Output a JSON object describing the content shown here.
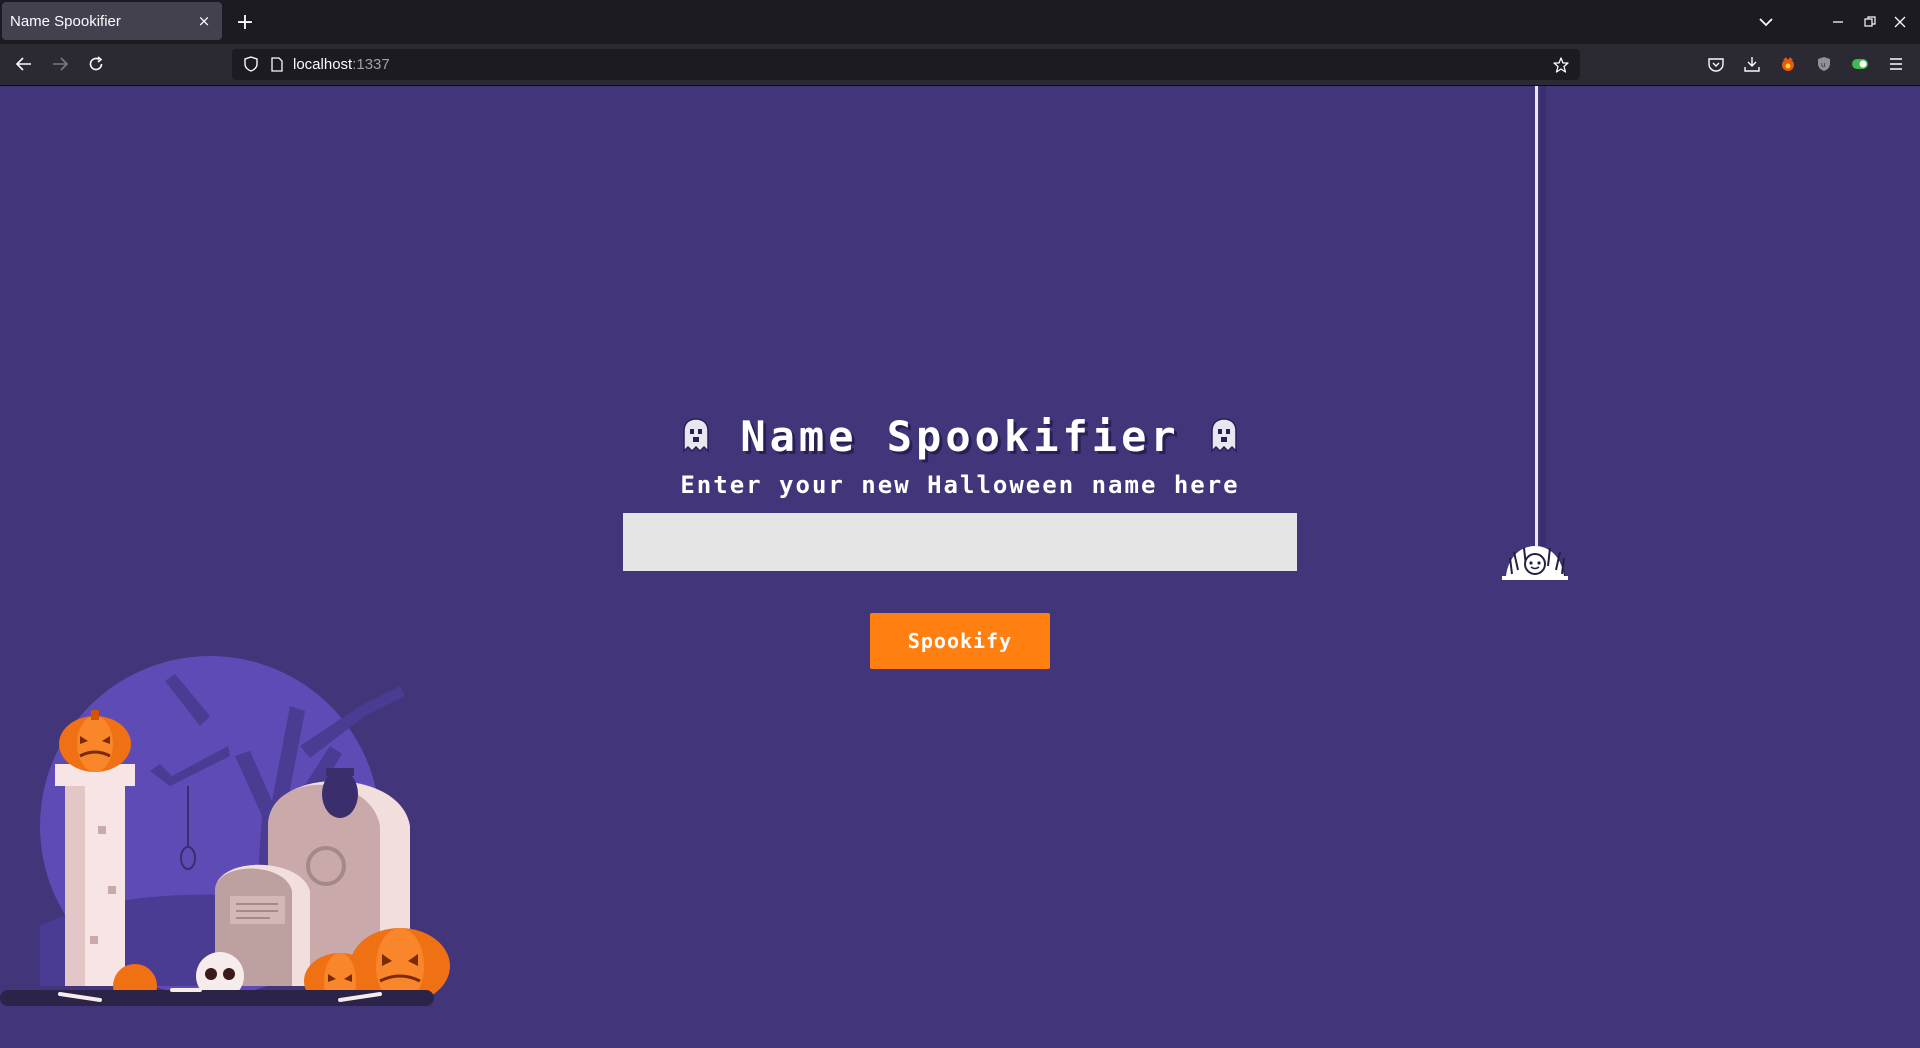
{
  "browser": {
    "tab_title": "Name Spookifier",
    "tab_close": "×",
    "new_tab": "+",
    "url_host": "localhost",
    "url_port": ":1337"
  },
  "page": {
    "title": "Name Spookifier",
    "subtitle": "Enter your new Halloween name here",
    "input_value": "",
    "button_label": "Spookify"
  },
  "colors": {
    "background": "#42357a",
    "button": "#ff7f11",
    "input": "#e5e5e5"
  }
}
